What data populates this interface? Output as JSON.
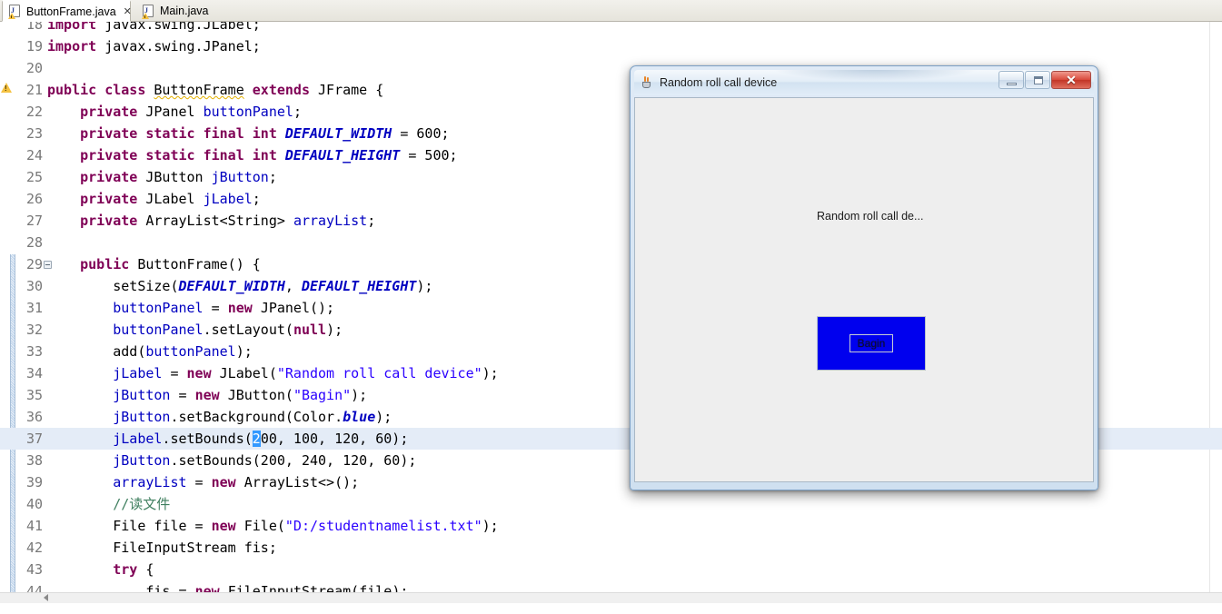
{
  "ide": {
    "tabs": [
      {
        "label": "ButtonFrame.java",
        "active": true,
        "close_glyph": "✕",
        "icon": "java-file-warning-icon"
      },
      {
        "label": "Main.java",
        "active": false,
        "close_glyph": "",
        "icon": "java-file-warning-icon"
      }
    ]
  },
  "editor": {
    "first_visible_line": 18,
    "current_line": 37,
    "warning_line": 21,
    "fold_line": 29,
    "selected_char": "2",
    "lines": [
      {
        "no": "18",
        "parts": [
          {
            "t": "import ",
            "c": "kw"
          },
          {
            "t": "javax.swing.JLabel;",
            "c": "plain"
          }
        ]
      },
      {
        "no": "19",
        "parts": [
          {
            "t": "import ",
            "c": "kw"
          },
          {
            "t": "javax.swing.JPanel;",
            "c": "plain"
          }
        ]
      },
      {
        "no": "20",
        "parts": []
      },
      {
        "no": "21",
        "parts": [
          {
            "t": "public ",
            "c": "kw"
          },
          {
            "t": "class ",
            "c": "kw"
          },
          {
            "t": "ButtonFrame",
            "c": "plain",
            "squiggle": true
          },
          {
            "t": " ",
            "c": "plain"
          },
          {
            "t": "extends ",
            "c": "kw"
          },
          {
            "t": "JFrame {",
            "c": "plain"
          }
        ]
      },
      {
        "no": "22",
        "parts": [
          {
            "t": "    ",
            "c": "plain"
          },
          {
            "t": "private ",
            "c": "kw"
          },
          {
            "t": "JPanel ",
            "c": "plain"
          },
          {
            "t": "buttonPanel",
            "c": "fld"
          },
          {
            "t": ";",
            "c": "plain"
          }
        ]
      },
      {
        "no": "23",
        "parts": [
          {
            "t": "    ",
            "c": "plain"
          },
          {
            "t": "private static final int ",
            "c": "kw"
          },
          {
            "t": "DEFAULT_WIDTH",
            "c": "sfld"
          },
          {
            "t": " = 600;",
            "c": "plain"
          }
        ]
      },
      {
        "no": "24",
        "parts": [
          {
            "t": "    ",
            "c": "plain"
          },
          {
            "t": "private static final int ",
            "c": "kw"
          },
          {
            "t": "DEFAULT_HEIGHT",
            "c": "sfld"
          },
          {
            "t": " = 500;",
            "c": "plain"
          }
        ]
      },
      {
        "no": "25",
        "parts": [
          {
            "t": "    ",
            "c": "plain"
          },
          {
            "t": "private ",
            "c": "kw"
          },
          {
            "t": "JButton ",
            "c": "plain"
          },
          {
            "t": "jButton",
            "c": "fld"
          },
          {
            "t": ";",
            "c": "plain"
          }
        ]
      },
      {
        "no": "26",
        "parts": [
          {
            "t": "    ",
            "c": "plain"
          },
          {
            "t": "private ",
            "c": "kw"
          },
          {
            "t": "JLabel ",
            "c": "plain"
          },
          {
            "t": "jLabel",
            "c": "fld"
          },
          {
            "t": ";",
            "c": "plain"
          }
        ]
      },
      {
        "no": "27",
        "parts": [
          {
            "t": "    ",
            "c": "plain"
          },
          {
            "t": "private ",
            "c": "kw"
          },
          {
            "t": "ArrayList<String> ",
            "c": "plain"
          },
          {
            "t": "arrayList",
            "c": "fld"
          },
          {
            "t": ";",
            "c": "plain"
          }
        ]
      },
      {
        "no": "28",
        "parts": []
      },
      {
        "no": "29",
        "parts": [
          {
            "t": "    ",
            "c": "plain"
          },
          {
            "t": "public ",
            "c": "kw"
          },
          {
            "t": "ButtonFrame() {",
            "c": "plain"
          }
        ]
      },
      {
        "no": "30",
        "parts": [
          {
            "t": "        setSize(",
            "c": "plain"
          },
          {
            "t": "DEFAULT_WIDTH",
            "c": "sfld"
          },
          {
            "t": ", ",
            "c": "plain"
          },
          {
            "t": "DEFAULT_HEIGHT",
            "c": "sfld"
          },
          {
            "t": ");",
            "c": "plain"
          }
        ]
      },
      {
        "no": "31",
        "parts": [
          {
            "t": "        ",
            "c": "plain"
          },
          {
            "t": "buttonPanel",
            "c": "fld"
          },
          {
            "t": " = ",
            "c": "plain"
          },
          {
            "t": "new ",
            "c": "kw"
          },
          {
            "t": "JPanel();",
            "c": "plain"
          }
        ]
      },
      {
        "no": "32",
        "parts": [
          {
            "t": "        ",
            "c": "plain"
          },
          {
            "t": "buttonPanel",
            "c": "fld"
          },
          {
            "t": ".setLayout(",
            "c": "plain"
          },
          {
            "t": "null",
            "c": "kw"
          },
          {
            "t": ");",
            "c": "plain"
          }
        ]
      },
      {
        "no": "33",
        "parts": [
          {
            "t": "        add(",
            "c": "plain"
          },
          {
            "t": "buttonPanel",
            "c": "fld"
          },
          {
            "t": ");",
            "c": "plain"
          }
        ]
      },
      {
        "no": "34",
        "parts": [
          {
            "t": "        ",
            "c": "plain"
          },
          {
            "t": "jLabel",
            "c": "fld"
          },
          {
            "t": " = ",
            "c": "plain"
          },
          {
            "t": "new ",
            "c": "kw"
          },
          {
            "t": "JLabel(",
            "c": "plain"
          },
          {
            "t": "\"Random roll call device\"",
            "c": "str"
          },
          {
            "t": ");",
            "c": "plain"
          }
        ]
      },
      {
        "no": "35",
        "parts": [
          {
            "t": "        ",
            "c": "plain"
          },
          {
            "t": "jButton",
            "c": "fld"
          },
          {
            "t": " = ",
            "c": "plain"
          },
          {
            "t": "new ",
            "c": "kw"
          },
          {
            "t": "JButton(",
            "c": "plain"
          },
          {
            "t": "\"Bagin\"",
            "c": "str"
          },
          {
            "t": ");",
            "c": "plain"
          }
        ]
      },
      {
        "no": "36",
        "parts": [
          {
            "t": "        ",
            "c": "plain"
          },
          {
            "t": "jButton",
            "c": "fld"
          },
          {
            "t": ".setBackground(Color.",
            "c": "plain"
          },
          {
            "t": "blue",
            "c": "sfld"
          },
          {
            "t": ");",
            "c": "plain"
          }
        ]
      },
      {
        "no": "37",
        "parts": [
          {
            "t": "        ",
            "c": "plain"
          },
          {
            "t": "jLabel",
            "c": "fld"
          },
          {
            "t": ".setBounds(",
            "c": "plain"
          },
          {
            "t": "2",
            "c": "plain",
            "selected": true
          },
          {
            "t": "00, 100, 120, 60);",
            "c": "plain"
          }
        ]
      },
      {
        "no": "38",
        "parts": [
          {
            "t": "        ",
            "c": "plain"
          },
          {
            "t": "jButton",
            "c": "fld"
          },
          {
            "t": ".setBounds(200, 240, 120, 60);",
            "c": "plain"
          }
        ]
      },
      {
        "no": "39",
        "parts": [
          {
            "t": "        ",
            "c": "plain"
          },
          {
            "t": "arrayList",
            "c": "fld"
          },
          {
            "t": " = ",
            "c": "plain"
          },
          {
            "t": "new ",
            "c": "kw"
          },
          {
            "t": "ArrayList<>();",
            "c": "plain"
          }
        ]
      },
      {
        "no": "40",
        "parts": [
          {
            "t": "        ",
            "c": "plain"
          },
          {
            "t": "//读文件",
            "c": "cmt"
          }
        ]
      },
      {
        "no": "41",
        "parts": [
          {
            "t": "        ",
            "c": "plain"
          },
          {
            "t": "File ",
            "c": "plain"
          },
          {
            "t": "file",
            "c": "plain"
          },
          {
            "t": " = ",
            "c": "plain"
          },
          {
            "t": "new ",
            "c": "kw"
          },
          {
            "t": "File(",
            "c": "plain"
          },
          {
            "t": "\"D:/studentnamelist.txt\"",
            "c": "str"
          },
          {
            "t": ");",
            "c": "plain"
          }
        ]
      },
      {
        "no": "42",
        "parts": [
          {
            "t": "        FileInputStream ",
            "c": "plain"
          },
          {
            "t": "fis",
            "c": "plain"
          },
          {
            "t": ";",
            "c": "plain"
          }
        ]
      },
      {
        "no": "43",
        "parts": [
          {
            "t": "        ",
            "c": "plain"
          },
          {
            "t": "try ",
            "c": "kw"
          },
          {
            "t": "{",
            "c": "plain"
          }
        ]
      },
      {
        "no": "44",
        "parts": [
          {
            "t": "            ",
            "c": "plain"
          },
          {
            "t": "fis",
            "c": "plain"
          },
          {
            "t": " = ",
            "c": "plain"
          },
          {
            "t": "new ",
            "c": "kw"
          },
          {
            "t": "FileInputStream(",
            "c": "plain"
          },
          {
            "t": "file",
            "c": "plain"
          },
          {
            "t": ");",
            "c": "plain"
          }
        ]
      }
    ]
  },
  "swing_window": {
    "title": "Random roll call device",
    "label_text": "Random roll call de...",
    "button_text": "Bagin",
    "button_color": "#0000ee",
    "panel_color": "#eeeeee",
    "minimize_glyph": "",
    "maximize_glyph": "",
    "close_glyph": "✕"
  }
}
